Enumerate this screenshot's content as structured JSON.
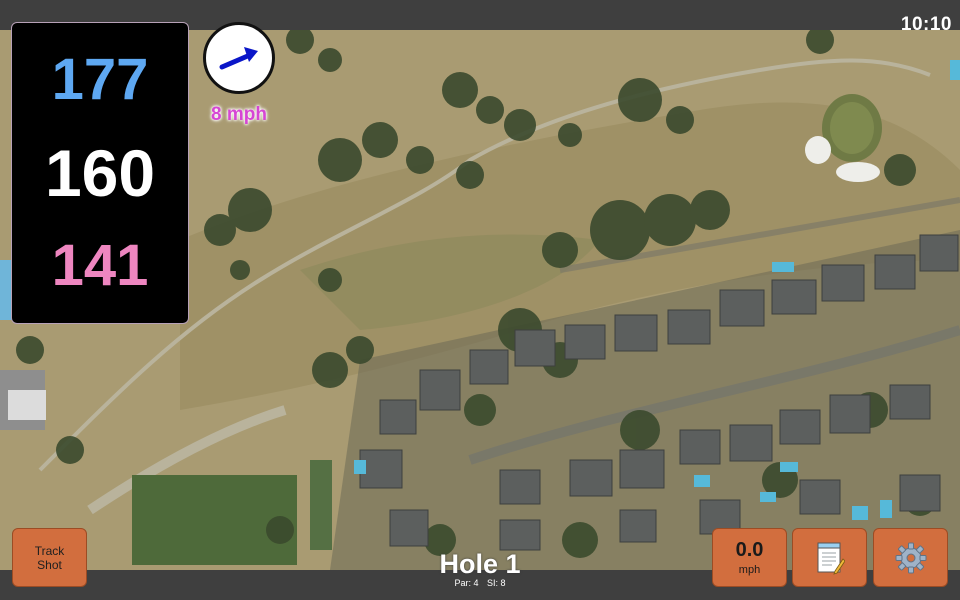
{
  "status": {
    "time": "10:10"
  },
  "distances": {
    "back": "177",
    "middle": "160",
    "front": "141"
  },
  "wind": {
    "speed": "8 mph",
    "arrow_icon": "wind-direction-arrow"
  },
  "hole": {
    "title": "Hole 1",
    "par": "Par: 4",
    "si": "SI: 8"
  },
  "buttons": {
    "track_shot_line1": "Track",
    "track_shot_line2": "Shot",
    "speed_value": "0.0",
    "speed_unit": "mph",
    "notes_icon": "notepad-icon",
    "settings_icon": "gear-icon"
  },
  "colors": {
    "back_distance": "#5ea8f2",
    "middle_distance": "#ffffff",
    "front_distance": "#ee86c0",
    "wind_speed": "#d646d4",
    "button": "#d26e3e"
  }
}
